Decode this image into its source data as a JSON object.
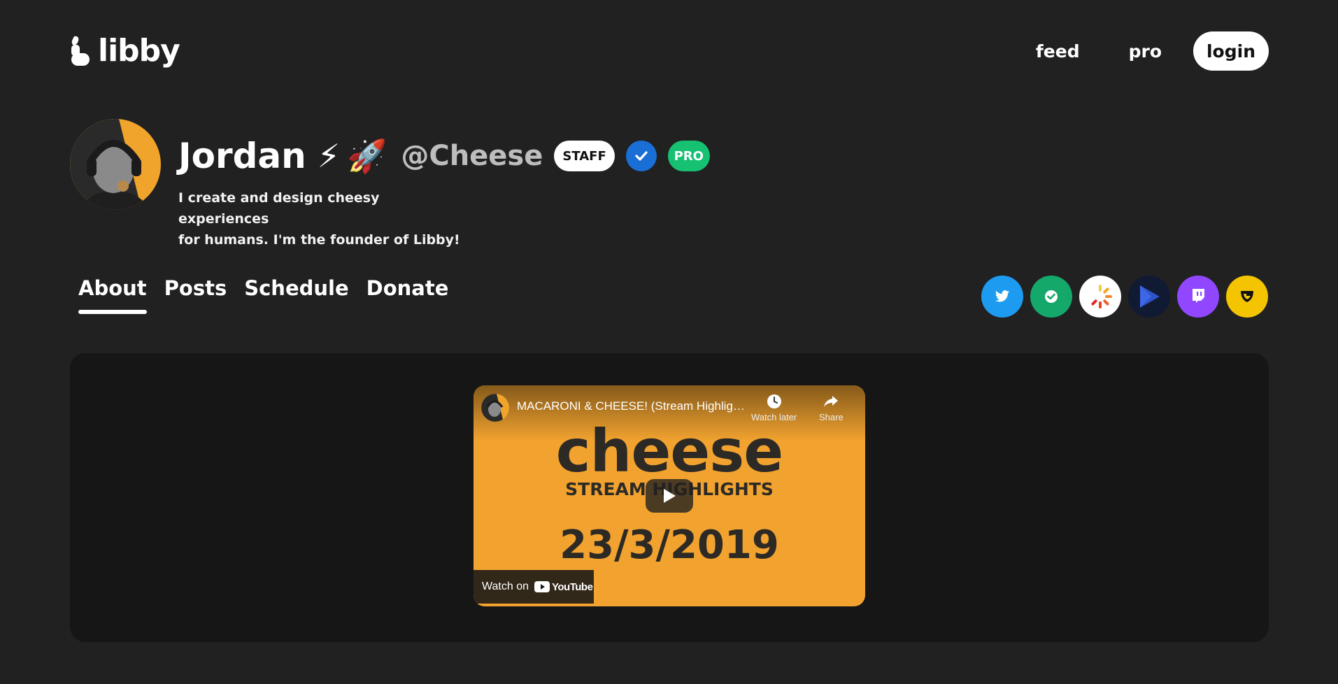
{
  "header": {
    "logo_text": "libby",
    "nav": [
      {
        "label": "feed"
      },
      {
        "label": "pro"
      }
    ],
    "login_label": "login"
  },
  "profile": {
    "name": "Jordan",
    "emojis": [
      "⚡",
      "🚀"
    ],
    "handle": "@Cheese",
    "badges": {
      "staff": "STAFF",
      "pro": "PRO"
    },
    "bio_line1": "I create and design cheesy experiences",
    "bio_line2": "for humans. I'm the founder of Libby!"
  },
  "tabs": [
    {
      "label": "About",
      "active": true
    },
    {
      "label": "Posts",
      "active": false
    },
    {
      "label": "Schedule",
      "active": false
    },
    {
      "label": "Donate",
      "active": false
    }
  ],
  "socials": [
    {
      "name": "twitter",
      "color": "#1d9bf0"
    },
    {
      "name": "checkmark",
      "color": "#14a86b"
    },
    {
      "name": "spinner",
      "color": "#ffffff"
    },
    {
      "name": "play-store",
      "color": "#101a33"
    },
    {
      "name": "twitch",
      "color": "#9146ff"
    },
    {
      "name": "guilded",
      "color": "#f5c400"
    }
  ],
  "video": {
    "title": "MACARONI & CHEESE! (Stream Highlights)",
    "watch_later": "Watch later",
    "share": "Share",
    "thumb_word": "cheese",
    "thumb_sub": "STREAM HIGHLIGHTS",
    "thumb_date": "23/3/2019",
    "watch_on": "Watch on",
    "yt_text": "YouTube"
  },
  "colors": {
    "background": "#212121",
    "card": "#161616",
    "accent_orange": "#f2a32f",
    "verified_blue": "#1a6fd6",
    "pro_green": "#16c172"
  }
}
